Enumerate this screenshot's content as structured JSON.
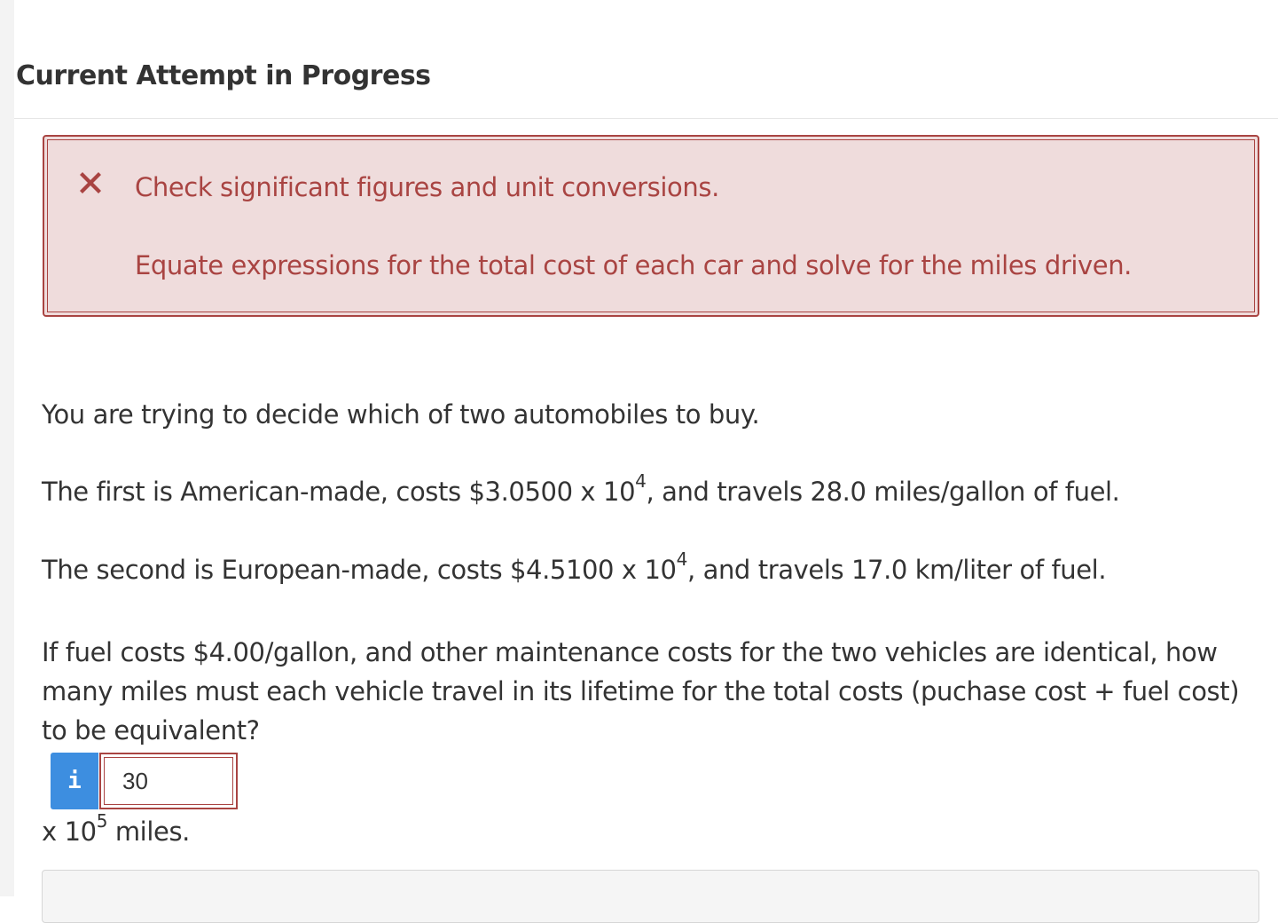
{
  "header": {
    "title": "Current Attempt in Progress"
  },
  "feedback": {
    "icon": "x-mark-icon",
    "color": "#a94442",
    "background": "#efdcdc",
    "line1": "Check significant figures and unit conversions.",
    "line2": "Equate expressions for the total cost of each car and solve for the miles driven."
  },
  "question": {
    "intro": "You are trying to decide which of two automobiles to buy.",
    "car1_prefix": "The first is American-made, costs $3.0500 x 10",
    "car1_exp": "4",
    "car1_suffix": ", and travels 28.0 miles/gallon of fuel.",
    "car2_prefix": "The second is European-made, costs $4.5100 x 10",
    "car2_exp": "4",
    "car2_suffix": ", and travels 17.0 km/liter of fuel.",
    "prompt": "If fuel costs $4.00/gallon, and other maintenance costs for the two vehicles are identical, how many miles must each vehicle travel in its lifetime for the total costs (puchase cost + fuel cost) to be equivalent?"
  },
  "answer": {
    "info_label": "i",
    "value": "30",
    "units_prefix": "x 10",
    "units_exp": "5",
    "units_suffix": " miles.",
    "info_color": "#3d8ee0"
  }
}
